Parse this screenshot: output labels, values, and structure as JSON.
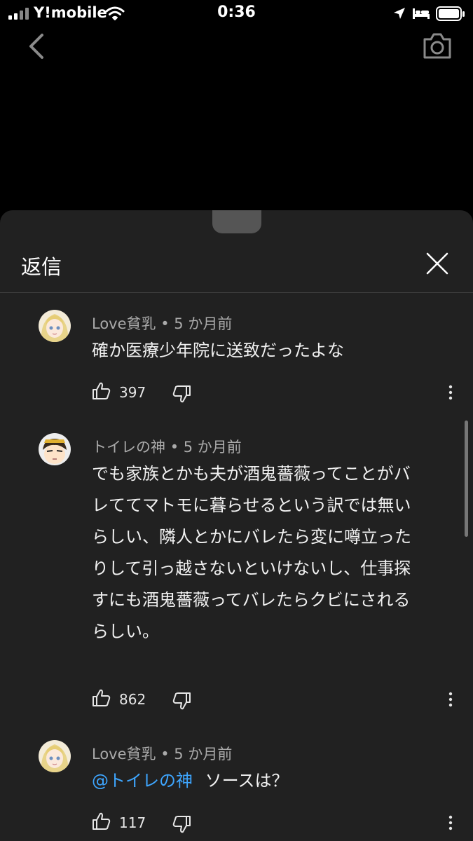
{
  "status": {
    "carrier": "Y!mobile",
    "time": "0:36"
  },
  "sheet": {
    "title": "返信"
  },
  "comments": [
    {
      "author": "Love貧乳",
      "age": "5 か月前",
      "text": "確か医療少年院に送致だったよな",
      "likes": "397"
    },
    {
      "author": "トイレの神",
      "age": "5 か月前",
      "lines": [
        "でも家族とかも夫が酒鬼薔薇ってことがバ",
        "レててマトモに暮らせるという訳では無い",
        "らしい、隣人とかにバレたら変に噂立った",
        "りして引っ越さないといけないし、仕事探",
        "すにも酒鬼薔薇ってバレたらクビにされる",
        "らしい。"
      ],
      "likes": "862"
    },
    {
      "author": "Love貧乳",
      "age": "5 か月前",
      "mention": "@トイレの神",
      "text": "ソースは？",
      "likes": "117"
    }
  ],
  "icons": {
    "back": "chevron-left-icon",
    "camera": "camera-icon",
    "close": "close-icon",
    "like": "thumbs-up-icon",
    "dislike": "thumbs-down-icon",
    "more": "more-vertical-icon"
  }
}
